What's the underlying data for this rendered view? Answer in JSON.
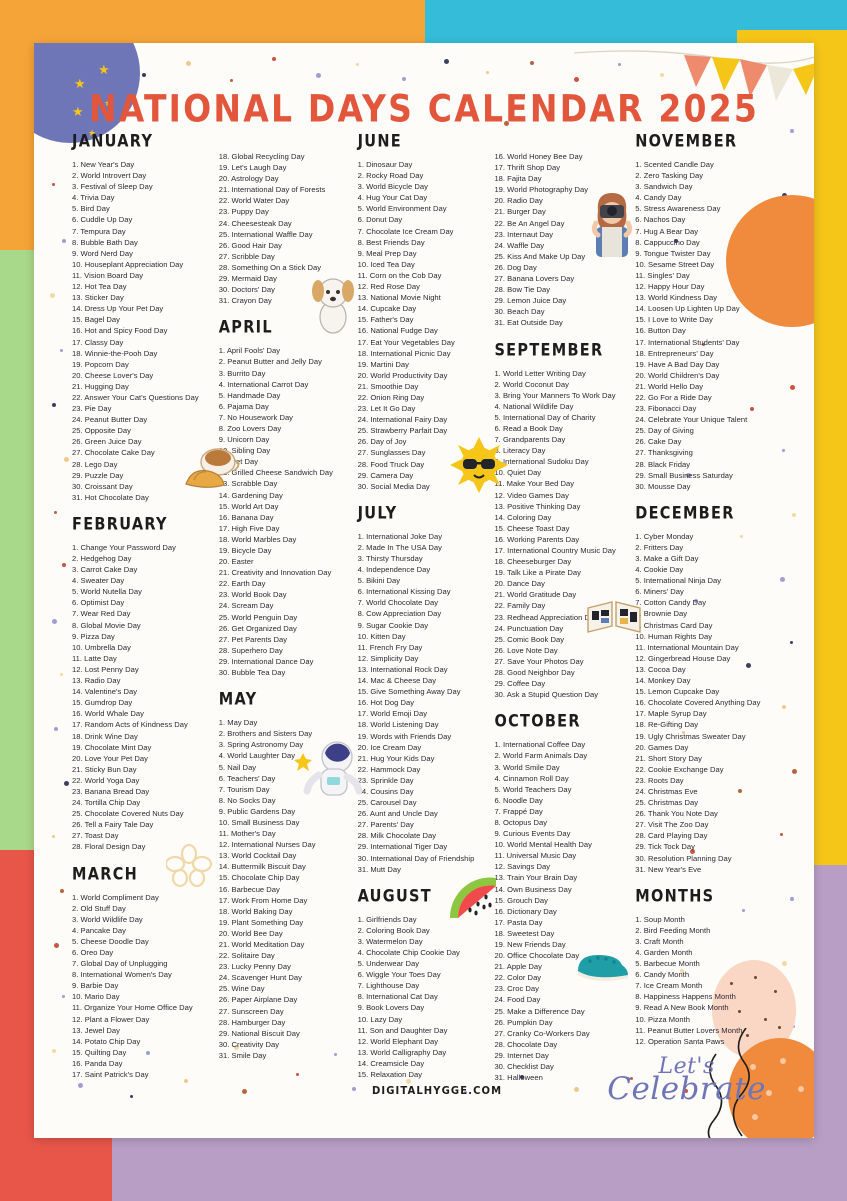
{
  "page": {
    "title": "NATIONAL DAYS CALENDAR 2025",
    "footer_url": "DIGITALHYGGE.COM",
    "celebrate_line1": "Let's",
    "celebrate_line2": "Celebrate",
    "colors": {
      "title": "#e2563c",
      "sheet": "#fdfcf8",
      "bg_orange": "#f5a437",
      "bg_cyan": "#35bcd8",
      "bg_yellow": "#f5c518",
      "bg_green": "#a8d88a",
      "bg_red": "#e8564a",
      "bg_purple": "#b89ec4",
      "moon": "#6f76b8",
      "script": "#6f76b8",
      "balloon_orange": "#f08a3c",
      "balloon_pink": "#fad6c4"
    }
  },
  "months": [
    {
      "name": "JANUARY",
      "days": [
        "1. New Year's Day",
        "2. World Introvert Day",
        "3. Festival of Sleep Day",
        "4. Trivia Day",
        "5. Bird Day",
        "6. Cuddle Up Day",
        "7. Tempura Day",
        "8. Bubble Bath Day",
        "9. Word Nerd Day",
        "10. Houseplant Appreciation Day",
        "11. Vision Board Day",
        "12. Hot Tea Day",
        "13. Sticker Day",
        "14. Dress Up Your Pet Day",
        "15. Bagel Day",
        "16. Hot and Spicy Food Day",
        "17. Classy Day",
        "18. Winnie-the-Pooh Day",
        "19. Popcorn Day",
        "20. Cheese Lover's Day",
        "21. Hugging Day",
        "22. Answer Your Cat's Questions Day",
        "23. Pie Day",
        "24. Peanut Butter Day",
        "25. Opposite Day",
        "26. Green Juice Day",
        "27. Chocolate Cake Day",
        "28. Lego Day",
        "29. Puzzle Day",
        "30. Croissant Day",
        "31. Hot Chocolate Day"
      ]
    },
    {
      "name": "FEBRUARY",
      "days": [
        "1. Change Your Password Day",
        "2. Hedgehog Day",
        "3. Carrot Cake Day",
        "4. Sweater Day",
        "5. World Nutella Day",
        "6. Optimist Day",
        "7. Wear Red Day",
        "8. Global Movie Day",
        "9. Pizza Day",
        "10. Umbrella Day",
        "11. Latte Day",
        "12. Lost Penny Day",
        "13. Radio Day",
        "14. Valentine's Day",
        "15. Gumdrop Day",
        "16. World Whale Day",
        "17. Random Acts of Kindness Day",
        "18. Drink Wine Day",
        "19. Chocolate Mint Day",
        "20. Love Your Pet Day",
        "21. Sticky Bun Day",
        "22. World Yoga Day",
        "23. Banana Bread Day",
        "24. Tortilla Chip Day",
        "25. Chocolate Covered Nuts Day",
        "26. Tell a Fairy Tale Day",
        "27. Toast Day",
        "28. Floral Design Day"
      ]
    },
    {
      "name": "MARCH",
      "days": [
        "1. World Compliment Day",
        "2. Old Stuff Day",
        "3. World Wildlife Day",
        "4. Pancake Day",
        "5. Cheese Doodle Day",
        "6. Oreo Day",
        "7. Global Day of Unplugging",
        "8. International Women's Day",
        "9. Barbie Day",
        "10. Mario Day",
        "11. Organize Your Home Office Day",
        "12. Plant a Flower Day",
        "13. Jewel Day",
        "14. Potato Chip Day",
        "15. Quilting Day",
        "16. Panda Day",
        "17. Saint Patrick's Day"
      ]
    },
    {
      "name": "MARCH_CONT",
      "days": [
        "18. Global Recycling Day",
        "19. Let's Laugh Day",
        "20. Astrology Day",
        "21. International Day of Forests",
        "22. World Water Day",
        "23. Puppy Day",
        "24. Cheesesteak Day",
        "25. International Waffle Day",
        "26. Good Hair Day",
        "27. Scribble Day",
        "28. Something On a Stick Day",
        "29. Mermaid Day",
        "30. Doctors' Day",
        "31. Crayon Day"
      ]
    },
    {
      "name": "APRIL",
      "days": [
        "1. April Fools' Day",
        "2. Peanut Butter and Jelly Day",
        "3. Burrito Day",
        "4. International Carrot Day",
        "5. Handmade Day",
        "6. Pajama Day",
        "7. No Housework Day",
        "8. Zoo Lovers Day",
        "9. Unicorn Day",
        "10. Sibling Day",
        "11. Pet Day",
        "12. Grilled Cheese Sandwich Day",
        "13. Scrabble Day",
        "14. Gardening Day",
        "15. World Art Day",
        "16. Banana Day",
        "17. High Five Day",
        "18. World Marbles Day",
        "19. Bicycle Day",
        "20. Easter",
        "21. Creativity and Innovation Day",
        "22. Earth Day",
        "23. World Book Day",
        "24. Scream Day",
        "25. World Penguin Day",
        "26. Get Organized Day",
        "27. Pet Parents Day",
        "28. Superhero Day",
        "29. International Dance Day",
        "30. Bubble Tea Day"
      ]
    },
    {
      "name": "MAY",
      "days": [
        "1. May Day",
        "2. Brothers and Sisters Day",
        "3. Spring Astronomy Day",
        "4. World Laughter Day",
        "5. Nail Day",
        "6. Teachers' Day",
        "7. Tourism Day",
        "8. No Socks Day",
        "9. Public Gardens Day",
        "10. Small Business Day",
        "11. Mother's Day",
        "12. International Nurses Day",
        "13. World Cocktail Day",
        "14. Buttermilk Biscuit Day",
        "15. Chocolate Chip Day",
        "16. Barbecue Day",
        "17. Work From Home Day",
        "18. World Baking Day",
        "19. Plant Something Day",
        "20. World Bee Day",
        "21. World Meditation Day",
        "22. Solitaire Day",
        "23. Lucky Penny Day",
        "24. Scavenger Hunt Day",
        "25. Wine Day",
        "26. Paper Airplane Day",
        "27. Sunscreen Day",
        "28. Hamburger Day",
        "29. National Biscuit Day",
        "30. Creativity Day",
        "31. Smile Day"
      ]
    },
    {
      "name": "JUNE",
      "days": [
        "1. Dinosaur Day",
        "2. Rocky Road Day",
        "3. World Bicycle Day",
        "4. Hug Your Cat Day",
        "5. World Environment Day",
        "6. Donut Day",
        "7. Chocolate Ice Cream Day",
        "8. Best Friends Day",
        "9. Meal Prep Day",
        "10. Iced Tea Day",
        "11. Corn on the Cob Day",
        "12. Red Rose Day",
        "13. National Movie Night",
        "14. Cupcake Day",
        "15. Father's Day",
        "16. National Fudge Day",
        "17. Eat Your Vegetables Day",
        "18. International Picnic Day",
        "19. Martini Day",
        "20. World Productivity Day",
        "21. Smoothie Day",
        "22. Onion Ring Day",
        "23. Let It Go Day",
        "24. International Fairy Day",
        "25. Strawberry Parfait Day",
        "26. Day of Joy",
        "27. Sunglasses Day",
        "28. Food Truck Day",
        "29. Camera Day",
        "30. Social Media Day"
      ]
    },
    {
      "name": "JULY",
      "days": [
        "1. International Joke Day",
        "2. Made In The USA Day",
        "3. Thirsty Thursday",
        "4. Independence Day",
        "5. Bikini Day",
        "6. International Kissing Day",
        "7. World Chocolate Day",
        "8. Cow Appreciation Day",
        "9. Sugar Cookie Day",
        "10. Kitten Day",
        "11. French Fry Day",
        "12. Simplicity Day",
        "13. International Rock Day",
        "14. Mac & Cheese Day",
        "15. Give Something Away Day",
        "16. Hot Dog Day",
        "17. World Emoji Day",
        "18. World Listening Day",
        "19. Words with Friends Day",
        "20. Ice Cream Day",
        "21. Hug Your Kids Day",
        "22. Hammock Day",
        "23. Sprinkle Day",
        "24. Cousins Day",
        "25. Carousel Day",
        "26. Aunt and Uncle Day",
        "27. Parents' Day",
        "28. Milk Chocolate Day",
        "29. International Tiger Day",
        "30. International Day of Friendship",
        "31. Mutt Day"
      ]
    },
    {
      "name": "AUGUST",
      "days": [
        "1. Girlfriends Day",
        "2. Coloring Book Day",
        "3. Watermelon Day",
        "4. Chocolate Chip Cookie Day",
        "5. Underwear Day",
        "6. Wiggle Your Toes Day",
        "7. Lighthouse Day",
        "8. International Cat Day",
        "9. Book Lovers Day",
        "10. Lazy Day",
        "11. Son and Daughter Day",
        "12. World Elephant Day",
        "13. World Calligraphy Day",
        "14. Creamsicle Day",
        "15. Relaxation Day"
      ]
    },
    {
      "name": "AUGUST_CONT",
      "days": [
        "16. World Honey Bee Day",
        "17. Thrift Shop Day",
        "18. Fajita Day",
        "19. World Photography Day",
        "20. Radio Day",
        "21. Burger Day",
        "22. Be An Angel Day",
        "23. Internaut Day",
        "24. Waffle Day",
        "25. Kiss And Make Up Day",
        "26. Dog Day",
        "27. Banana Lovers Day",
        "28. Bow Tie Day",
        "29. Lemon Juice Day",
        "30. Beach Day",
        "31. Eat Outside Day"
      ]
    },
    {
      "name": "SEPTEMBER",
      "days": [
        "1. World Letter Writing Day",
        "2. World Coconut Day",
        "3. Bring Your Manners To Work Day",
        "4. National Wildlife Day",
        "5. International Day of Charity",
        "6. Read a Book Day",
        "7. Grandparents Day",
        "8. Literacy Day",
        "9. International Sudoku Day",
        "10. Quiet Day",
        "11. Make Your Bed Day",
        "12. Video Games Day",
        "13. Positive Thinking Day",
        "14. Coloring Day",
        "15. Cheese Toast Day",
        "16. Working Parents Day",
        "17. International Country Music Day",
        "18. Cheeseburger Day",
        "19. Talk Like a Pirate Day",
        "20. Dance Day",
        "21. World Gratitude Day",
        "22. Family Day",
        "23. Redhead Appreciation Day",
        "24. Punctuation Day",
        "25. Comic Book Day",
        "26. Love Note Day",
        "27. Save Your Photos Day",
        "28. Good Neighbor Day",
        "29. Coffee Day",
        "30. Ask a Stupid Question Day"
      ]
    },
    {
      "name": "OCTOBER",
      "days": [
        "1. International Coffee Day",
        "2. World Farm Animals Day",
        "3. World Smile Day",
        "4. Cinnamon Roll Day",
        "5. World Teachers Day",
        "6. Noodle Day",
        "7. Frappé Day",
        "8. Octopus Day",
        "9. Curious Events Day",
        "10. World Mental Health Day",
        "11. Universal Music Day",
        "12. Savings Day",
        "13. Train Your Brain Day",
        "14. Own Business Day",
        "15. Grouch Day",
        "16. Dictionary Day",
        "17. Pasta Day",
        "18. Sweetest Day",
        "19. New Friends Day",
        "20. Office Chocolate Day",
        "21. Apple Day",
        "22. Color Day",
        "23. Croc Day",
        "24. Food Day",
        "25. Make a Difference Day",
        "26. Pumpkin Day",
        "27. Cranky Co-Workers Day",
        "28. Chocolate Day",
        "29. Internet Day",
        "30. Checklist Day",
        "31. Halloween"
      ]
    },
    {
      "name": "NOVEMBER",
      "days": [
        "1. Scented Candle Day",
        "2. Zero Tasking Day",
        "3. Sandwich Day",
        "4. Candy Day",
        "5. Stress Awareness Day",
        "6. Nachos Day",
        "7. Hug A Bear Day",
        "8. Cappuccino Day",
        "9. Tongue Twister Day",
        "10. Sesame Street Day",
        "11. Singles' Day",
        "12. Happy Hour Day",
        "13. World Kindness Day",
        "14. Loosen Up Lighten Up Day",
        "15. I Love to Write Day",
        "16. Button Day",
        "17. International Students' Day",
        "18. Entrepreneurs' Day",
        "19. Have A Bad Day Day",
        "20. World Children's Day",
        "21. World Hello Day",
        "22. Go For a Ride Day",
        "23. Fibonacci Day",
        "24. Celebrate Your Unique Talent",
        "25. Day of Giving",
        "26. Cake Day",
        "27. Thanksgiving",
        "28. Black Friday",
        "29. Small Business Saturday",
        "30. Mousse Day"
      ]
    },
    {
      "name": "DECEMBER",
      "days": [
        "1. Cyber Monday",
        "2. Fritters Day",
        "3. Make a Gift Day",
        "4. Cookie Day",
        "5. International Ninja Day",
        "6. Miners' Day",
        "7. Cotton Candy Day",
        "8. Brownie Day",
        "9. Christmas Card Day",
        "10. Human Rights Day",
        "11. International Mountain Day",
        "12. Gingerbread House Day",
        "13. Cocoa Day",
        "14. Monkey Day",
        "15. Lemon Cupcake Day",
        "16. Chocolate Covered Anything Day",
        "17. Maple Syrup Day",
        "18. Re-Gifting Day",
        "19. Ugly Christmas Sweater Day",
        "20. Games Day",
        "21. Short Story Day",
        "22. Cookie Exchange Day",
        "23. Roots Day",
        "24. Christmas Eve",
        "25. Christmas Day",
        "26. Thank You Note Day",
        "27. Visit The Zoo Day",
        "28. Card Playing Day",
        "29. Tick Tock Day",
        "30. Resolution Planning Day",
        "31. New Year's Eve"
      ]
    },
    {
      "name": "MONTHS",
      "days": [
        "1. Soup Month",
        "2. Bird Feeding Month",
        "3. Craft Month",
        "4. Garden Month",
        "5. Barbecue Month",
        "6. Candy Month",
        "7. Ice Cream Month",
        "8. Happiness Happens Month",
        "9. Read A New Book Month",
        "10. Pizza Month",
        "11. Peanut Butter Lovers Month",
        "12. Operation Santa Paws"
      ]
    }
  ],
  "illustrations": [
    {
      "name": "coffee-croissant-illustration",
      "month": "JANUARY"
    },
    {
      "name": "flower-doodle-illustration",
      "month": "MARCH"
    },
    {
      "name": "dog-illustration",
      "month": "MARCH_CONT"
    },
    {
      "name": "astronaut-illustration",
      "month": "MAY"
    },
    {
      "name": "sun-sunglasses-illustration",
      "month": "JUNE"
    },
    {
      "name": "watermelon-illustration",
      "month": "AUGUST"
    },
    {
      "name": "photographer-illustration",
      "month": "AUGUST_CONT"
    },
    {
      "name": "comic-book-illustration",
      "month": "SEPTEMBER"
    },
    {
      "name": "croc-shoe-illustration",
      "month": "OCTOBER"
    },
    {
      "name": "balloons-illustration",
      "month": "MONTHS"
    }
  ]
}
